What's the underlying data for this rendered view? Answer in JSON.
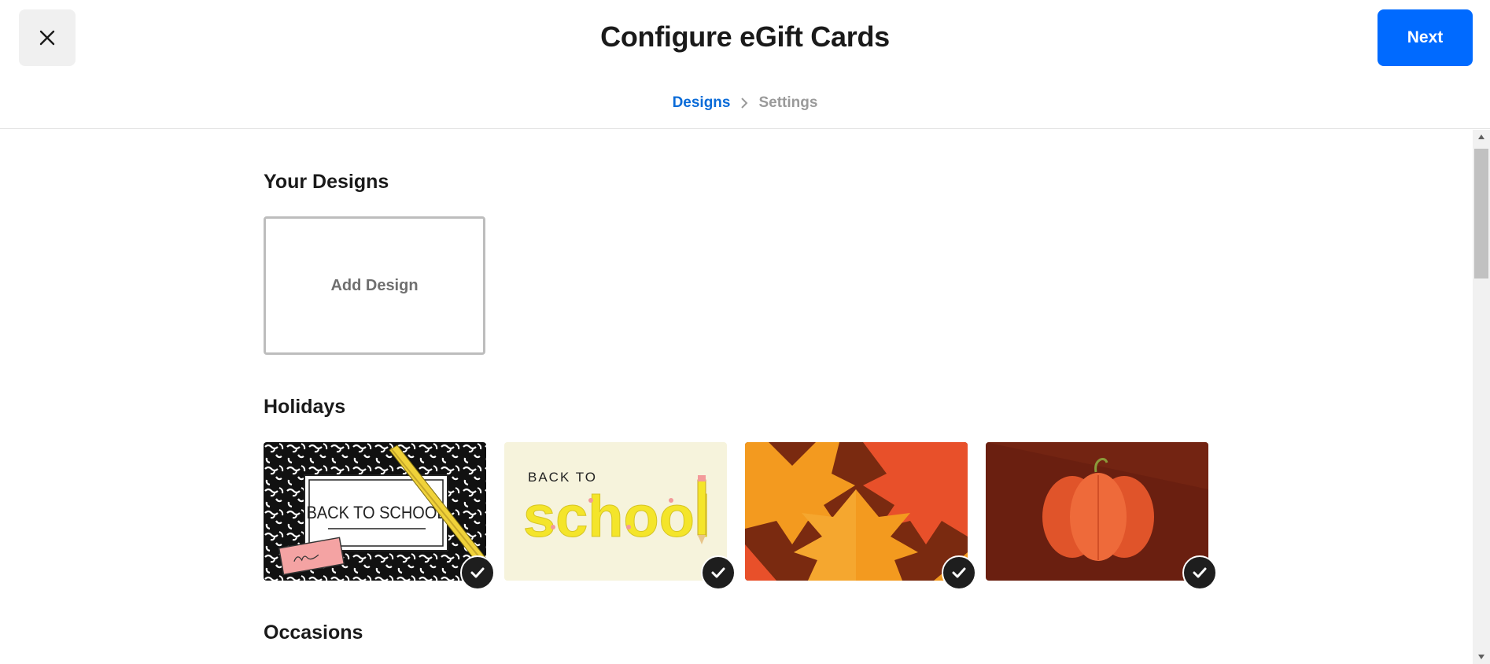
{
  "header": {
    "title": "Configure eGift Cards",
    "next_label": "Next",
    "close_icon": "close-icon"
  },
  "steps": {
    "designs_label": "Designs",
    "settings_label": "Settings"
  },
  "sections": {
    "your_designs": {
      "title": "Your Designs",
      "add_design_label": "Add Design"
    },
    "holidays": {
      "title": "Holidays",
      "cards": [
        {
          "design": "back-to-school-notebook",
          "text": "BACK TO SCHOOL",
          "selected": true
        },
        {
          "design": "back-to-school-pencils",
          "text_top": "BACK TO",
          "text_main": "school",
          "selected": true
        },
        {
          "design": "autumn-leaves",
          "selected": true
        },
        {
          "design": "pumpkin",
          "selected": true
        }
      ]
    },
    "occasions": {
      "title": "Occasions"
    }
  },
  "colors": {
    "accent": "#006aff",
    "step_active": "#0a6bd8",
    "step_inactive": "#9a9a9a"
  }
}
